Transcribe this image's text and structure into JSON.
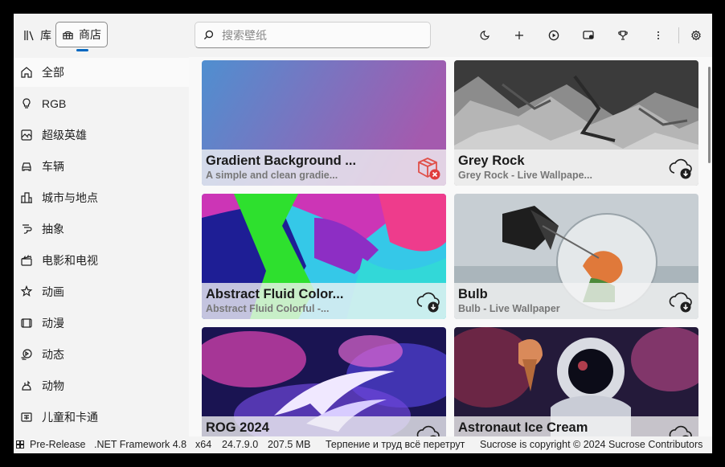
{
  "nav": {
    "library_label": "库",
    "store_label": "商店"
  },
  "search": {
    "placeholder": "搜索壁纸",
    "value": ""
  },
  "toolbar": {
    "icons": [
      "theme-toggle-icon",
      "add-icon",
      "play-icon",
      "display-icon",
      "trophy-icon",
      "more-icon",
      "settings-icon"
    ]
  },
  "sidebar": {
    "items": [
      {
        "label": "全部",
        "icon": "home-icon",
        "active": true
      },
      {
        "label": "RGB",
        "icon": "lightbulb-icon",
        "active": false
      },
      {
        "label": "超级英雄",
        "icon": "picture-icon",
        "active": false
      },
      {
        "label": "车辆",
        "icon": "car-icon",
        "active": false
      },
      {
        "label": "城市与地点",
        "icon": "city-icon",
        "active": false
      },
      {
        "label": "抽象",
        "icon": "abstract-icon",
        "active": false
      },
      {
        "label": "电影和电视",
        "icon": "clapperboard-icon",
        "active": false
      },
      {
        "label": "动画",
        "icon": "star-burst-icon",
        "active": false
      },
      {
        "label": "动漫",
        "icon": "film-frame-icon",
        "active": false
      },
      {
        "label": "动态",
        "icon": "motion-icon",
        "active": false
      },
      {
        "label": "动物",
        "icon": "animal-icon",
        "active": false
      },
      {
        "label": "儿童和卡通",
        "icon": "kids-icon",
        "active": false
      }
    ]
  },
  "wallpapers": [
    {
      "title": "Gradient Background ...",
      "subtitle": "A simple and clean gradie...",
      "status_icon": "incompatible-package-icon"
    },
    {
      "title": "Grey Rock",
      "subtitle": "Grey Rock - Live Wallpape...",
      "status_icon": "cloud-download-icon"
    },
    {
      "title": "Abstract Fluid Color...",
      "subtitle": "Abstract Fluid Colorful -...",
      "status_icon": "cloud-download-icon"
    },
    {
      "title": "Bulb",
      "subtitle": "Bulb - Live Wallpaper",
      "status_icon": "cloud-download-icon"
    },
    {
      "title": "ROG 2024",
      "subtitle": "",
      "status_icon": "cloud-download-icon"
    },
    {
      "title": "Astronaut Ice Cream",
      "subtitle": "",
      "status_icon": "cloud-download-icon"
    }
  ],
  "status": {
    "channel": "Pre-Release",
    "framework": ".NET Framework 4.8",
    "arch": "x64",
    "version": "24.7.9.0",
    "memory": "207.5 MB",
    "quote": "Терпение и труд всё перетрут",
    "copyright": "Sucrose is copyright © 2024 Sucrose Contributors"
  },
  "colors": {
    "accent": "#0067c0",
    "error": "#e03c3c",
    "window_bg": "#f3f3f3"
  }
}
